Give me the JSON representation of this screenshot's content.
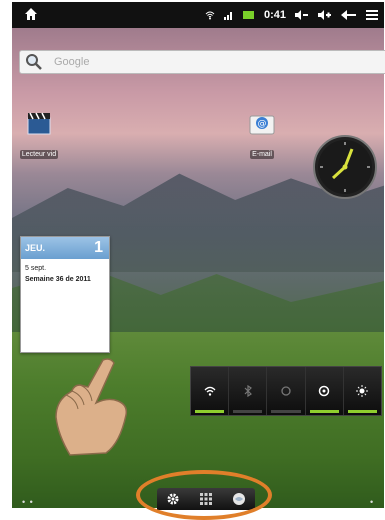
{
  "statusbar": {
    "time": "0:41",
    "icons": [
      "home-icon",
      "wifi-icon",
      "signal-icon",
      "battery-icon",
      "volume-down-icon",
      "volume-up-icon",
      "back-icon",
      "menu-icon"
    ]
  },
  "search": {
    "placeholder": "Google"
  },
  "apps": [
    {
      "label": "Lecteur vid",
      "icon": "video-player-icon"
    },
    {
      "label": "E-mail",
      "icon": "email-icon"
    }
  ],
  "calendar": {
    "day": "JEU.",
    "number": "1",
    "date": "5 sept.",
    "week": "Semaine 36 de 2011"
  },
  "power_widget": {
    "buttons": [
      {
        "name": "wifi",
        "icon": "wifi-icon",
        "on": true
      },
      {
        "name": "bluetooth",
        "icon": "bluetooth-icon",
        "on": false
      },
      {
        "name": "sync",
        "icon": "sync-icon",
        "on": false
      },
      {
        "name": "auto-rotate",
        "icon": "rotate-icon",
        "on": true
      },
      {
        "name": "brightness",
        "icon": "brightness-icon",
        "on": true
      }
    ]
  },
  "dock": {
    "items": [
      "settings-icon",
      "app-drawer-icon",
      "browser-icon"
    ]
  },
  "colors": {
    "highlight_ring": "#e07f2a",
    "toggle_on": "#8fce2e",
    "calendar_header": "#6a9fd0"
  }
}
